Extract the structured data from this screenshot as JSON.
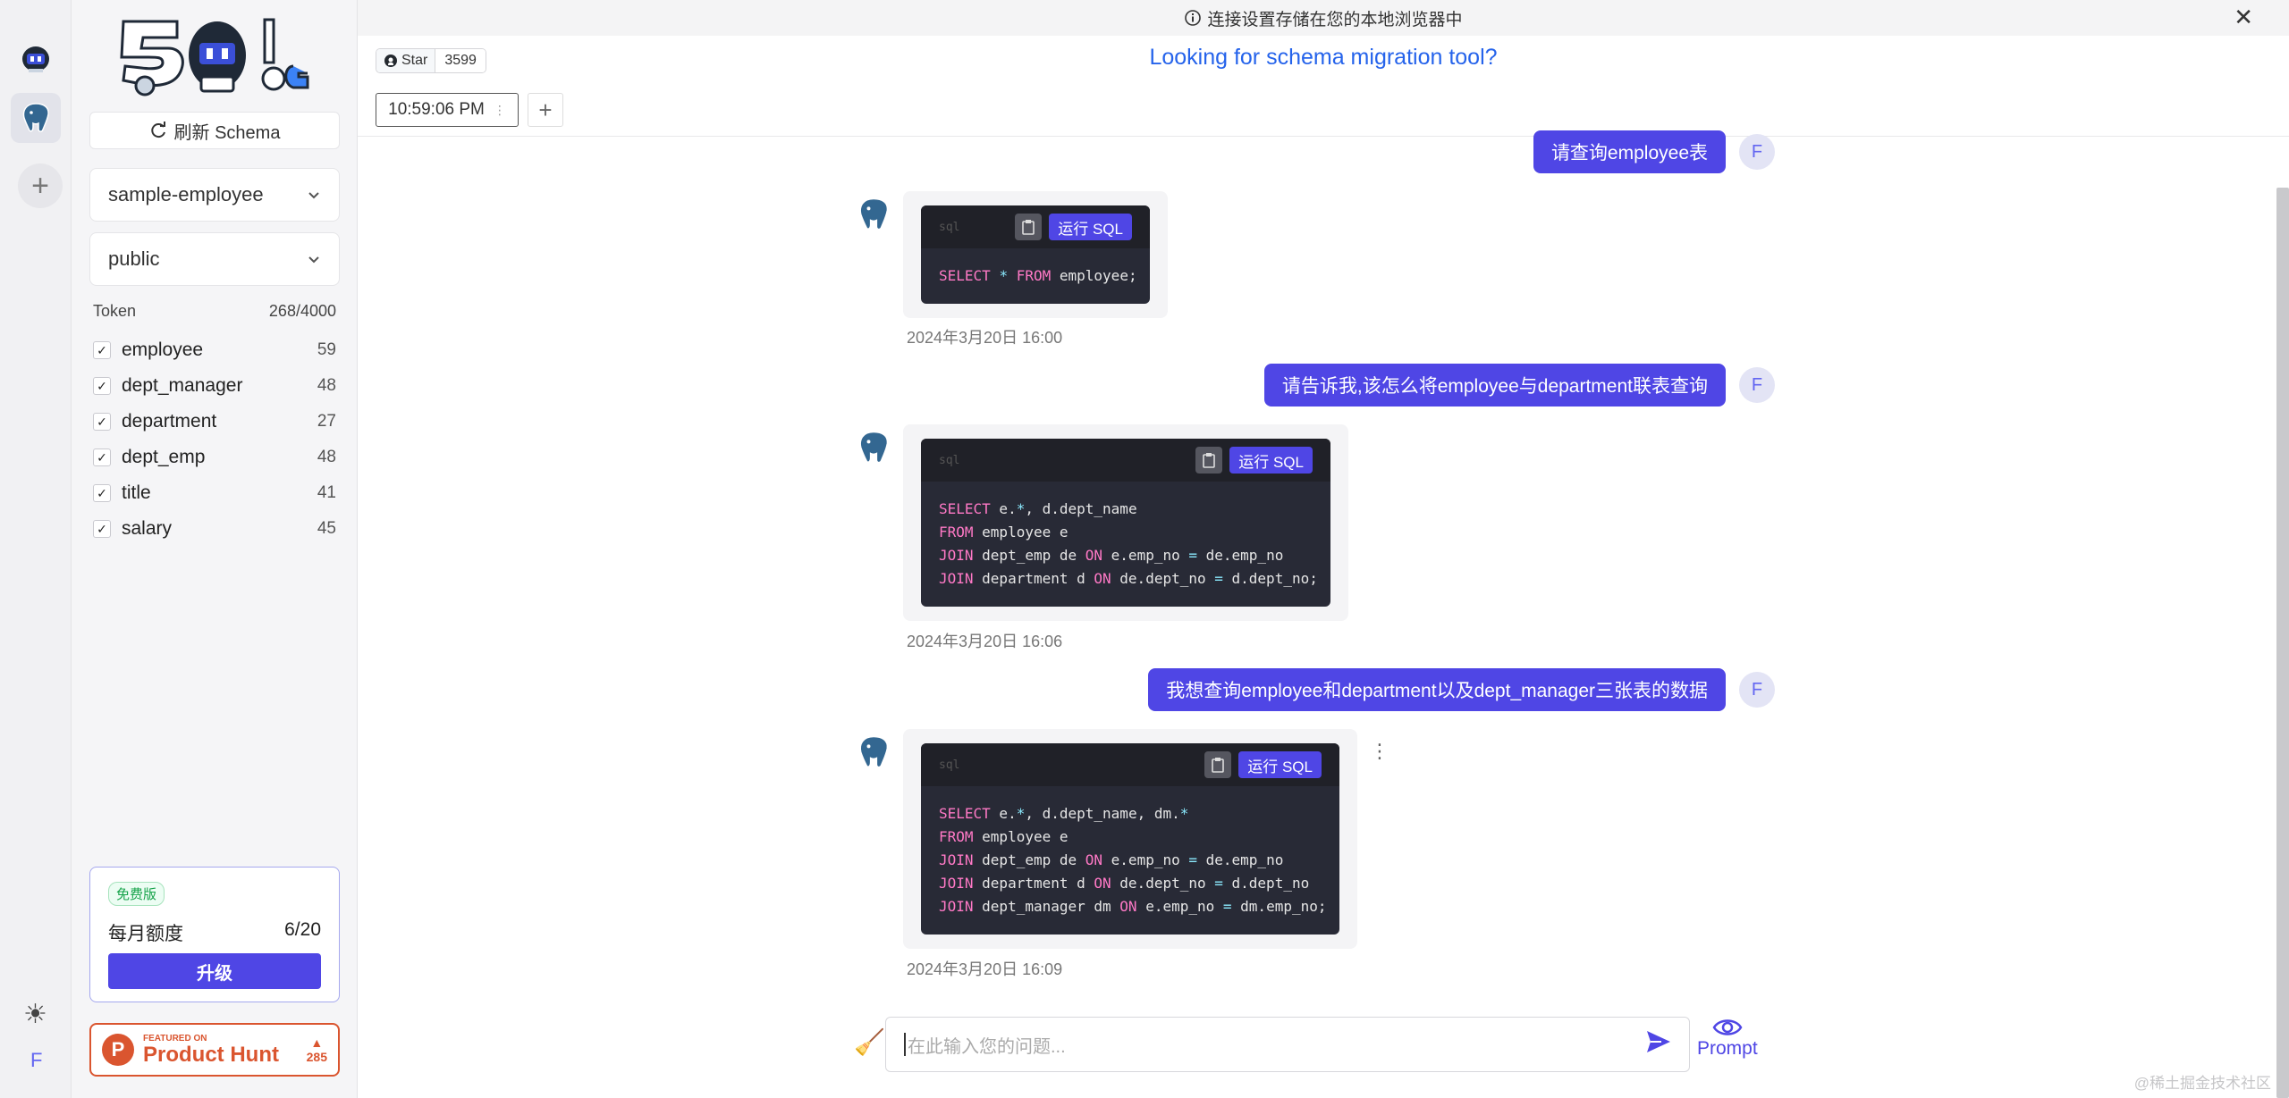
{
  "banner": {
    "text": "连接设置存储在您的本地浏览器中"
  },
  "sidebar": {
    "refresh_label": "刷新 Schema",
    "database": "sample-employee",
    "schema": "public",
    "token_label": "Token",
    "token_value": "268/4000",
    "tables": [
      {
        "name": "employee",
        "count": "59",
        "checked": true
      },
      {
        "name": "dept_manager",
        "count": "48",
        "checked": true
      },
      {
        "name": "department",
        "count": "27",
        "checked": true
      },
      {
        "name": "dept_emp",
        "count": "48",
        "checked": true
      },
      {
        "name": "title",
        "count": "41",
        "checked": true
      },
      {
        "name": "salary",
        "count": "45",
        "checked": true
      }
    ],
    "plan": {
      "badge": "免费版",
      "quota_label": "每月额度",
      "quota_value": "6/20",
      "upgrade_label": "升级"
    },
    "product_hunt": {
      "small": "FEATURED ON",
      "big": "Product Hunt",
      "votes": "285"
    }
  },
  "rail": {
    "user_initial": "F"
  },
  "header": {
    "github_star_label": "Star",
    "github_star_count": "3599",
    "schema_link": "Looking for schema migration tool?",
    "tab_time": "10:59:06 PM"
  },
  "chat": [
    {
      "role": "user",
      "text": "请查询employee表",
      "avatar": "F"
    },
    {
      "role": "bot",
      "lang": "sql",
      "run_label": "运行 SQL",
      "timestamp": "2024年3月20日 16:00"
    },
    {
      "role": "user",
      "text": "请告诉我,该怎么将employee与department联表查询",
      "avatar": "F"
    },
    {
      "role": "bot",
      "lang": "sql",
      "run_label": "运行 SQL",
      "timestamp": "2024年3月20日 16:06"
    },
    {
      "role": "user",
      "text": "我想查询employee和department以及dept_manager三张表的数据",
      "avatar": "F"
    },
    {
      "role": "bot",
      "lang": "sql",
      "run_label": "运行 SQL",
      "timestamp": "2024年3月20日 16:09"
    }
  ],
  "input": {
    "placeholder": "在此输入您的问题..."
  },
  "prompt_label": "Prompt",
  "watermark": "@稀土掘金技术社区",
  "colors": {
    "accent": "#4f46e5",
    "link": "#2563eb",
    "code_bg": "#282a36",
    "keyword": "#ff79c6",
    "operator": "#8be9fd"
  }
}
